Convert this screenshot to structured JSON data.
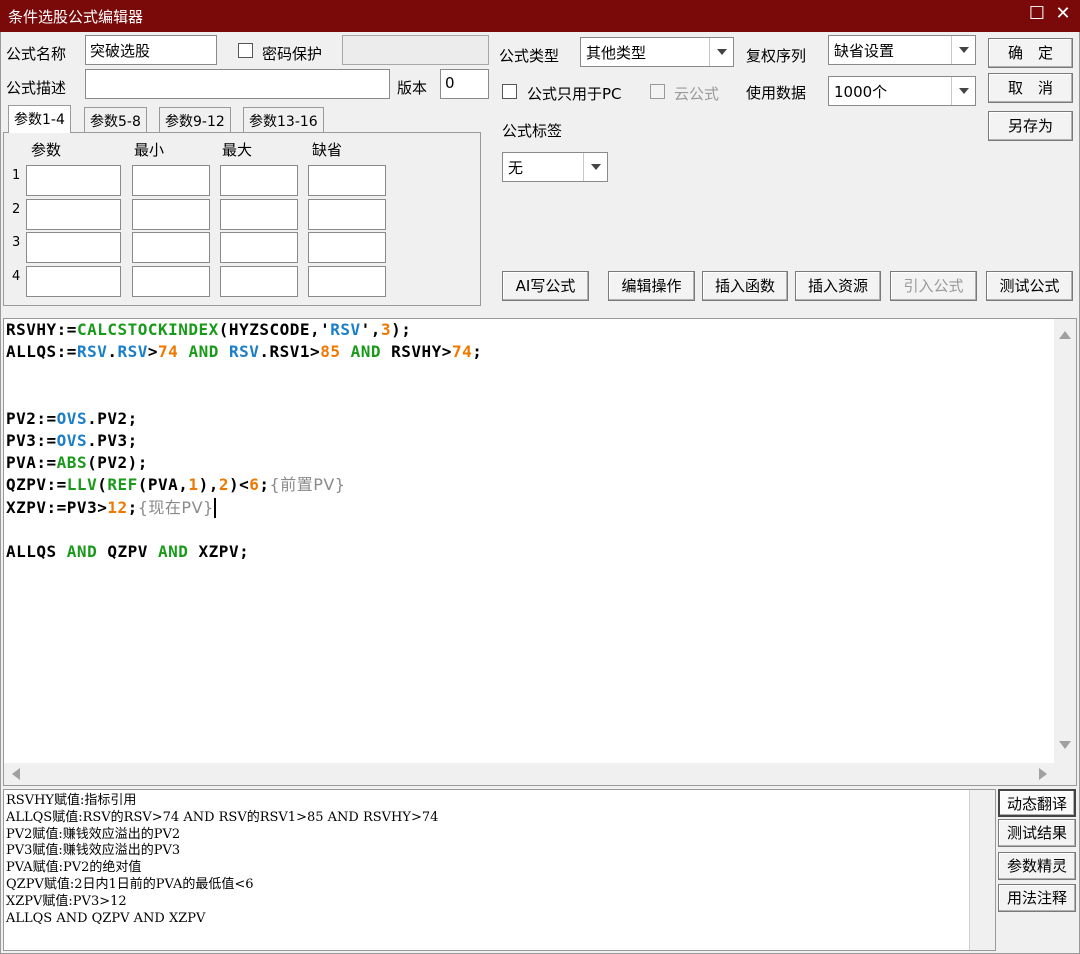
{
  "window": {
    "title": "条件选股公式编辑器",
    "maximize_glyph": "☐",
    "close_glyph": "✕"
  },
  "form": {
    "name_label": "公式名称",
    "name_value": "突破选股",
    "password_label": "密码保护",
    "password_value": "",
    "desc_label": "公式描述",
    "desc_value": "",
    "version_label": "版本",
    "version_value": "0",
    "type_label": "公式类型",
    "type_value": "其他类型",
    "fuquan_label": "复权序列",
    "fuquan_value": "缺省设置",
    "pc_only_label": "公式只用于PC",
    "cloud_label": "云公式",
    "use_data_label": "使用数据",
    "use_data_value": "1000个",
    "tag_label": "公式标签",
    "tag_value": "无"
  },
  "buttons": {
    "ok": "确　定",
    "cancel": "取　消",
    "save_as": "另存为",
    "ai_write": "AI写公式",
    "edit_ops": "编辑操作",
    "insert_func": "插入函数",
    "insert_res": "插入资源",
    "import": "引入公式",
    "test": "测试公式"
  },
  "tabs": [
    "参数1-4",
    "参数5-8",
    "参数9-12",
    "参数13-16"
  ],
  "param_table": {
    "headers": [
      "参数",
      "最小",
      "最大",
      "缺省"
    ],
    "rows": [
      "1",
      "2",
      "3",
      "4"
    ]
  },
  "code_lines": [
    [
      {
        "t": "RSVHY:=",
        "c": ""
      },
      {
        "t": "CALCSTOCKINDEX",
        "c": "kf"
      },
      {
        "t": "(HYZSCODE,'",
        "c": ""
      },
      {
        "t": "RSV",
        "c": "kv"
      },
      {
        "t": "',",
        "c": ""
      },
      {
        "t": "3",
        "c": "kn"
      },
      {
        "t": ");",
        "c": ""
      }
    ],
    [
      {
        "t": "ALLQS:=",
        "c": ""
      },
      {
        "t": "RSV",
        "c": "kv"
      },
      {
        "t": ".",
        "c": ""
      },
      {
        "t": "RSV",
        "c": "kv"
      },
      {
        "t": ">",
        "c": ""
      },
      {
        "t": "74",
        "c": "kn"
      },
      {
        "t": " ",
        "c": ""
      },
      {
        "t": "AND",
        "c": "kf"
      },
      {
        "t": " ",
        "c": ""
      },
      {
        "t": "RSV",
        "c": "kv"
      },
      {
        "t": ".RSV1>",
        "c": ""
      },
      {
        "t": "85",
        "c": "kn"
      },
      {
        "t": " ",
        "c": ""
      },
      {
        "t": "AND",
        "c": "kf"
      },
      {
        "t": " RSVHY>",
        "c": ""
      },
      {
        "t": "74",
        "c": "kn"
      },
      {
        "t": ";",
        "c": ""
      }
    ],
    [],
    [],
    [
      {
        "t": "PV2:=",
        "c": ""
      },
      {
        "t": "OVS",
        "c": "kv"
      },
      {
        "t": ".PV2;",
        "c": ""
      }
    ],
    [
      {
        "t": "PV3:=",
        "c": ""
      },
      {
        "t": "OVS",
        "c": "kv"
      },
      {
        "t": ".PV3;",
        "c": ""
      }
    ],
    [
      {
        "t": "PVA:=",
        "c": ""
      },
      {
        "t": "ABS",
        "c": "kf"
      },
      {
        "t": "(PV2);",
        "c": ""
      }
    ],
    [
      {
        "t": "QZPV:=",
        "c": ""
      },
      {
        "t": "LLV",
        "c": "kf"
      },
      {
        "t": "(",
        "c": ""
      },
      {
        "t": "REF",
        "c": "kf"
      },
      {
        "t": "(PVA,",
        "c": ""
      },
      {
        "t": "1",
        "c": "kn"
      },
      {
        "t": "),",
        "c": ""
      },
      {
        "t": "2",
        "c": "kn"
      },
      {
        "t": ")<",
        "c": ""
      },
      {
        "t": "6",
        "c": "kn"
      },
      {
        "t": ";",
        "c": ""
      },
      {
        "t": "{前置PV}",
        "c": "kc"
      }
    ],
    [
      {
        "t": "XZPV:=PV3>",
        "c": ""
      },
      {
        "t": "12",
        "c": "kn"
      },
      {
        "t": ";",
        "c": ""
      },
      {
        "t": "{现在PV}",
        "c": "kc"
      },
      {
        "t": "",
        "c": "caret"
      }
    ],
    [],
    [
      {
        "t": "ALLQS ",
        "c": ""
      },
      {
        "t": "AND",
        "c": "kf"
      },
      {
        "t": " QZPV ",
        "c": ""
      },
      {
        "t": "AND",
        "c": "kf"
      },
      {
        "t": " XZPV;",
        "c": ""
      }
    ]
  ],
  "translation_lines": [
    "RSVHY赋值:指标引用",
    "ALLQS赋值:RSV的RSV>74 AND RSV的RSV1>85 AND RSVHY>74",
    "PV2赋值:赚钱效应溢出的PV2",
    "PV3赋值:赚钱效应溢出的PV3",
    "PVA赋值:PV2的绝对值",
    "QZPV赋值:2日内1日前的PVA的最低值<6",
    "XZPV赋值:PV3>12",
    "ALLQS AND QZPV AND XZPV"
  ],
  "side_buttons": [
    "动态翻译",
    "测试结果",
    "参数精灵",
    "用法注释"
  ]
}
